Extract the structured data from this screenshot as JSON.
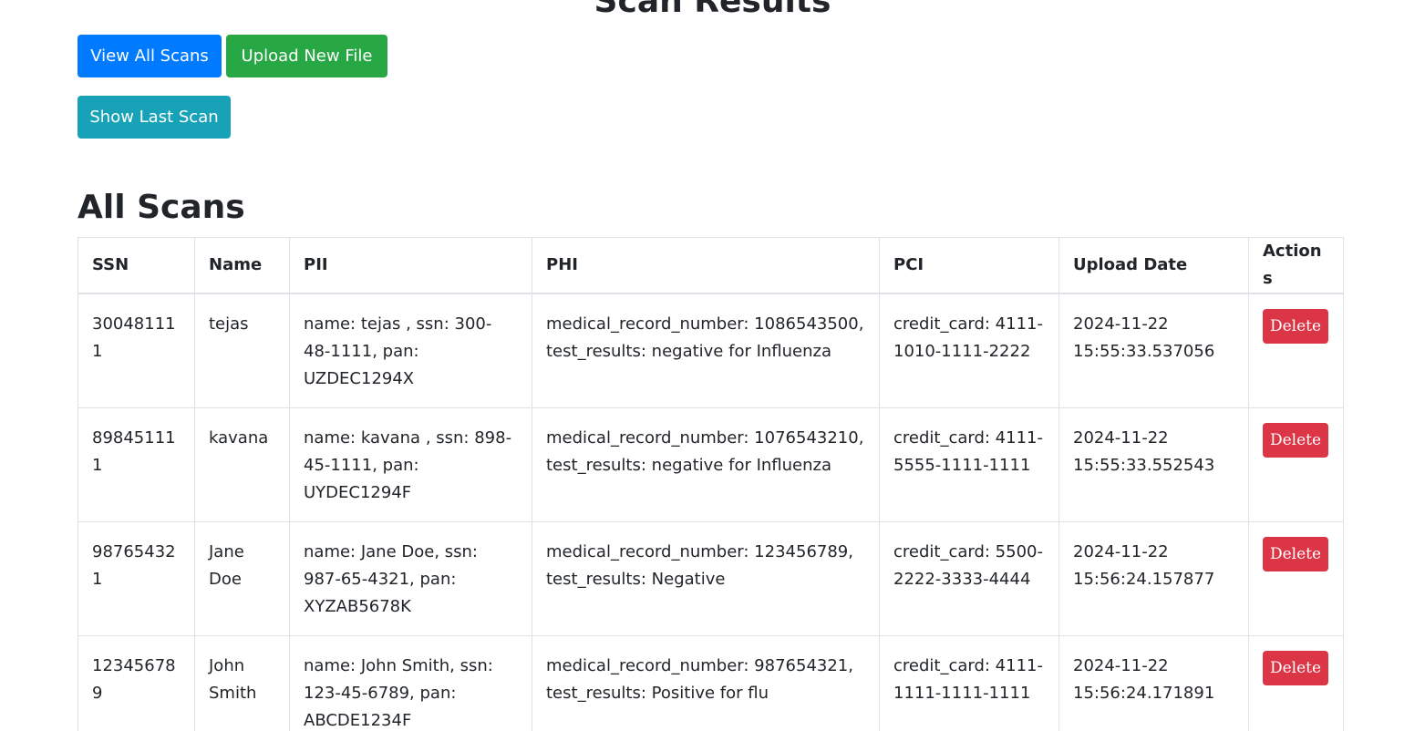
{
  "page_title": "Scan Results",
  "toolbar": {
    "view_all_label": "View All Scans",
    "upload_label": "Upload New File",
    "show_last_label": "Show Last Scan"
  },
  "section_title": "All Scans",
  "table": {
    "headers": [
      "SSN",
      "Name",
      "PII",
      "PHI",
      "PCI",
      "Upload Date",
      "Actions"
    ],
    "delete_label": "Delete",
    "rows": [
      {
        "ssn": "300481111",
        "name": "tejas",
        "pii": "name: tejas , ssn: 300-48-1111, pan: UZDEC1294X",
        "phi": "medical_record_number: 1086543500, test_results: negative for Influenza",
        "pci": "credit_card: 4111-1010-1111-2222",
        "upload_date": "2024-11-22 15:55:33.537056"
      },
      {
        "ssn": "898451111",
        "name": "kavana",
        "pii": "name: kavana , ssn: 898-45-1111, pan: UYDEC1294F",
        "phi": "medical_record_number: 1076543210, test_results: negative for Influenza",
        "pci": "credit_card: 4111-5555-1111-1111",
        "upload_date": "2024-11-22 15:55:33.552543"
      },
      {
        "ssn": "987654321",
        "name": "Jane Doe",
        "pii": "name: Jane Doe, ssn: 987-65-4321, pan: XYZAB5678K",
        "phi": "medical_record_number: 123456789, test_results: Negative",
        "pci": "credit_card: 5500-2222-3333-4444",
        "upload_date": "2024-11-22 15:56:24.157877"
      },
      {
        "ssn": "123456789",
        "name": "John Smith",
        "pii": "name: John Smith, ssn: 123-45-6789, pan: ABCDE1234F",
        "phi": "medical_record_number: 987654321, test_results: Positive for flu",
        "pci": "credit_card: 4111-1111-1111-1111",
        "upload_date": "2024-11-22 15:56:24.171891"
      }
    ]
  },
  "colors": {
    "primary": "#007bff",
    "success": "#28a745",
    "info": "#17a2b8",
    "danger": "#dc3545"
  }
}
